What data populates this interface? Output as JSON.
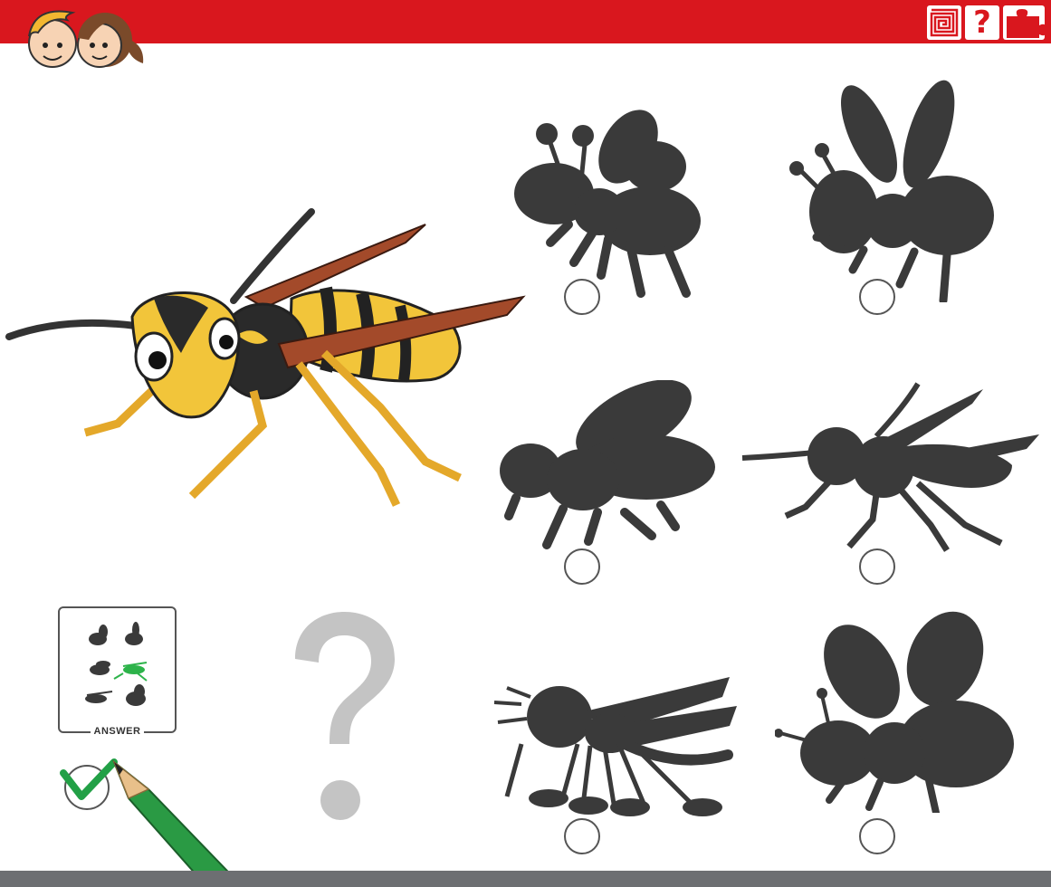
{
  "header": {
    "background_color": "#d9171e",
    "icons": [
      "maze-icon",
      "question-mark-icon",
      "puzzle-piece-icon"
    ],
    "question_glyph": "?"
  },
  "footer": {
    "background_color": "#6d6f72"
  },
  "puzzle": {
    "subject": "wasp",
    "shadow_color": "#3a3a3a",
    "options": [
      {
        "id": "shadow-1",
        "shape": "fly with round antennae"
      },
      {
        "id": "shadow-2",
        "shape": "fly with upright wings"
      },
      {
        "id": "shadow-3",
        "shape": "housefly"
      },
      {
        "id": "shadow-4",
        "shape": "wasp"
      },
      {
        "id": "shadow-5",
        "shape": "mosquito"
      },
      {
        "id": "shadow-6",
        "shape": "bee"
      }
    ],
    "correct_index": 3
  },
  "answer_card": {
    "label": "ANSWER",
    "highlight_color": "#2db34a"
  },
  "decorations": {
    "big_question_glyph": "?",
    "big_question_color": "#c4c4c4",
    "check_color": "#22a046",
    "pencil_color": "#2a9a44"
  }
}
